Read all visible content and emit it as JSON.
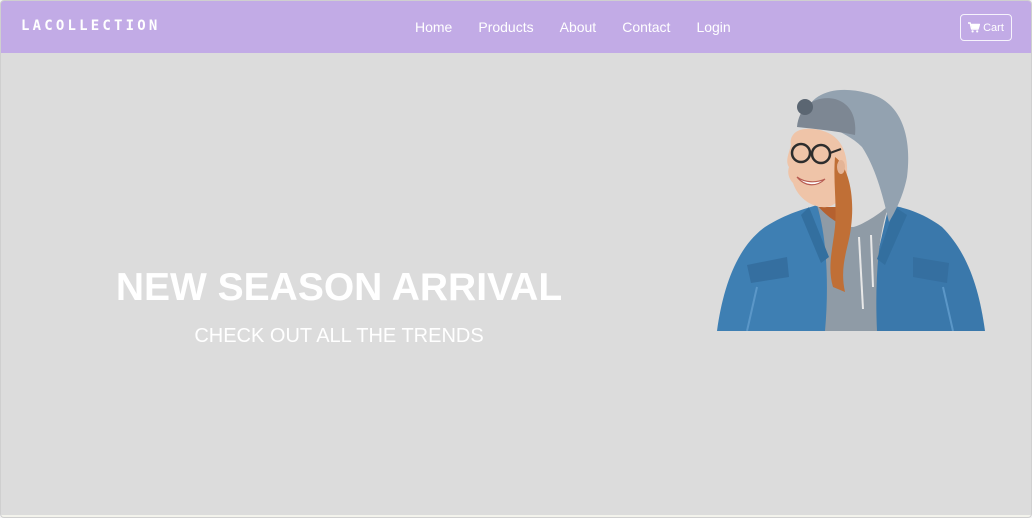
{
  "navbar": {
    "brand": "LACOLLECTION",
    "links": [
      "Home",
      "Products",
      "About",
      "Contact",
      "Login"
    ],
    "cart_label": "Cart",
    "background": "#c2abe6"
  },
  "hero": {
    "title": "NEW SEASON ARRIVAL",
    "subtitle": "CHECK OUT ALL THE TRENDS",
    "background": "#dcdcdc",
    "image_subject": "smiling-woman-in-grey-hoodie-and-denim-jacket"
  },
  "icons": {
    "cart": "shopping-cart-icon"
  }
}
